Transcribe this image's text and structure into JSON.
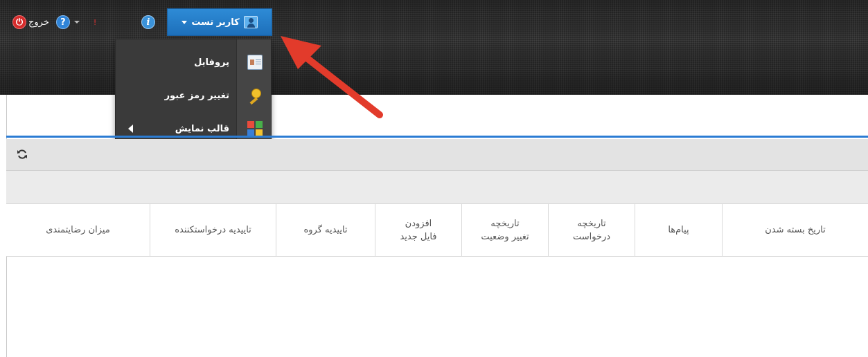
{
  "header": {
    "logout_label": "خروج",
    "user_menu_label": "کاربر تست",
    "help_icon_glyph": "?",
    "info_icon_glyph": "i",
    "alert_mark": "!",
    "colors": {
      "bar": "#2a2a2a",
      "user_button": "#2e8bd6",
      "logout": "#d52b2b",
      "accent_line": "#2b7cd3"
    }
  },
  "user_menu": {
    "items": [
      {
        "label": "پروفایل",
        "icon": "profile-card-icon"
      },
      {
        "label": "تغییر رمز عبور",
        "icon": "key-icon"
      },
      {
        "label": "قالب نمایش",
        "icon": "theme-icon",
        "has_submenu": true
      }
    ]
  },
  "toolbar": {
    "refresh_icon": "refresh-icon"
  },
  "table": {
    "columns": [
      {
        "label": "تاریخ بسته شدن"
      },
      {
        "label": "پیام‌ها"
      },
      {
        "label": "تاریخچه\nدرخواست"
      },
      {
        "label": "تاریخچه\nتغییر وضعیت"
      },
      {
        "label": "افزودن\nفایل جدید"
      },
      {
        "label": "تاییدیه گروه"
      },
      {
        "label": "تاییدیه درخواستکننده"
      },
      {
        "label": "میزان رضایتمندی"
      }
    ]
  },
  "annotation": {
    "type": "red-arrow",
    "points_to": "user-menu-button"
  }
}
